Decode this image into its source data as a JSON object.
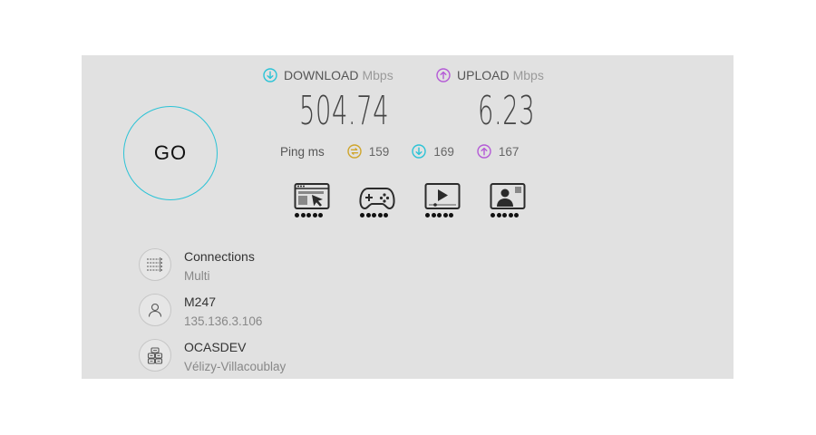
{
  "go_button": {
    "label": "GO"
  },
  "download": {
    "label": "DOWNLOAD",
    "unit": "Mbps",
    "value": "504.74",
    "icon": "arrow-down-circle-icon",
    "color": "#2bc3d6"
  },
  "upload": {
    "label": "UPLOAD",
    "unit": "Mbps",
    "value": "6.23",
    "icon": "arrow-up-circle-icon",
    "color": "#b45ad6"
  },
  "ping": {
    "label": "Ping ms",
    "idle": {
      "value": "159",
      "icon": "jitter-icon",
      "color": "#cfa52b"
    },
    "download": {
      "value": "169",
      "icon": "arrow-down-circle-icon",
      "color": "#2bc3d6"
    },
    "upload": {
      "value": "167",
      "icon": "arrow-up-circle-icon",
      "color": "#b45ad6"
    }
  },
  "usage_ratings": [
    {
      "name": "web-browsing-icon",
      "rating": 5
    },
    {
      "name": "gaming-icon",
      "rating": 5
    },
    {
      "name": "video-streaming-icon",
      "rating": 5
    },
    {
      "name": "video-call-icon",
      "rating": 5
    }
  ],
  "connections": {
    "title": "Connections",
    "value": "Multi",
    "icon": "connections-icon"
  },
  "provider": {
    "name": "M247",
    "ip": "135.136.3.106",
    "icon": "user-icon"
  },
  "server": {
    "name": "OCASDEV",
    "location": "Vélizy-Villacoublay",
    "icon": "server-icon"
  }
}
